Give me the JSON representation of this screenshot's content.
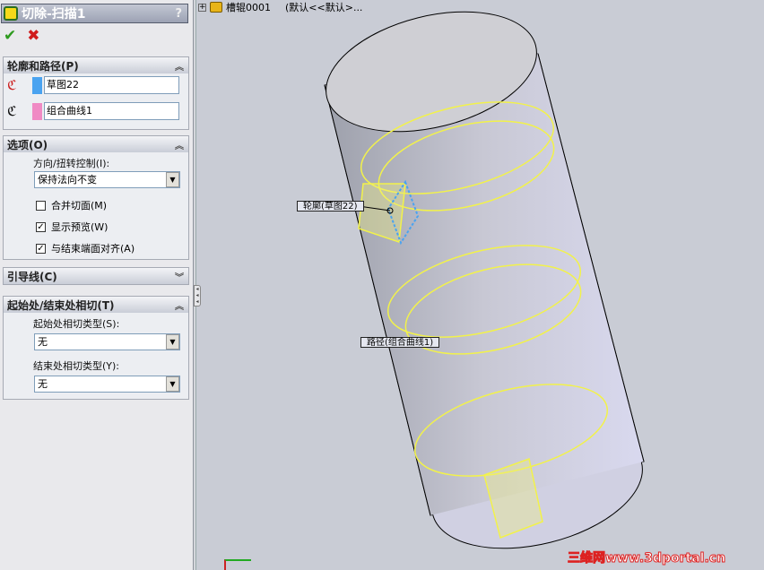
{
  "panel": {
    "title": "切除-扫描1",
    "help": "?",
    "ok_icon": "checkmark-icon",
    "cancel_icon": "x-icon",
    "profile_path": {
      "header": "轮廓和路径(P)",
      "profile": "草图22",
      "path": "组合曲线1",
      "profile_color": "#4aa3f0",
      "path_color": "#f08ac4"
    },
    "options": {
      "header": "选项(O)",
      "orientation_label": "方向/扭转控制(I):",
      "orientation_value": "保持法向不变",
      "merge": {
        "label": "合并切面(M)",
        "checked": false
      },
      "preview": {
        "label": "显示预览(W)",
        "checked": true
      },
      "align": {
        "label": "与结束端面对齐(A)",
        "checked": true
      }
    },
    "guides": {
      "header": "引导线(C)"
    },
    "tangency": {
      "header": "起始处/结束处相切(T)",
      "start_label": "起始处相切类型(S):",
      "start_value": "无",
      "end_label": "结束处相切类型(Y):",
      "end_value": "无"
    }
  },
  "tree": {
    "expander": "+",
    "name": "槽辊0001",
    "config": "(默认<<默认>..."
  },
  "viewport": {
    "profile_callout": "轮廓(草图22)",
    "path_callout": "路径(组合曲线1)"
  },
  "watermark": "三维网www.3dportal.cn"
}
